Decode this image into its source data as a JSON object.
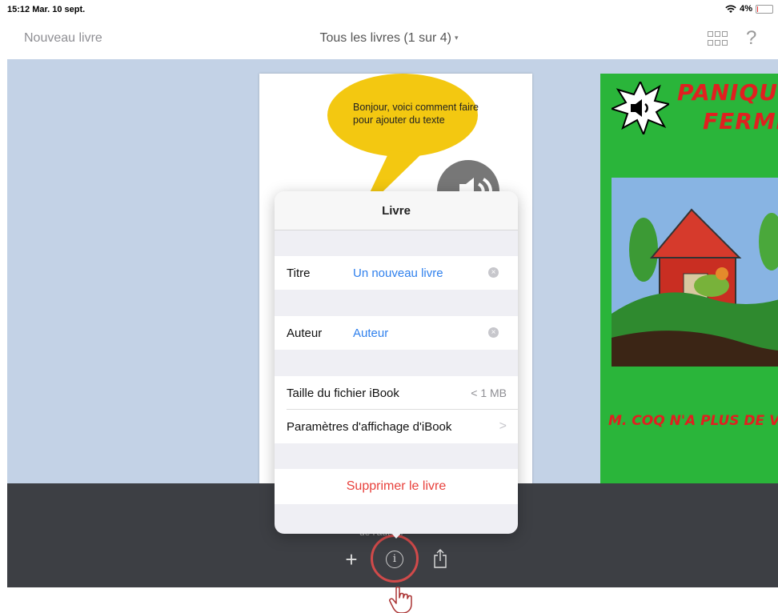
{
  "status_bar": {
    "time": "15:12  Mar. 10 sept.",
    "battery_percent_label": "4%",
    "battery_level": 0.04,
    "icons": [
      "wifi-icon",
      "battery-icon"
    ]
  },
  "nav": {
    "new_book": "Nouveau livre",
    "title": "Tous les livres (1 sur 4)",
    "title_caret": "▾",
    "help": "?",
    "icons": [
      "grid-icon",
      "help-icon"
    ]
  },
  "book_left": {
    "bubble_text": "Bonjour, voici comment faire pour ajouter du texte"
  },
  "book_right": {
    "title_line1": "PANIQUE",
    "title_line2": "FERMI",
    "subtitle": "M. COQ N'A PLUS DE VOI"
  },
  "popover": {
    "title": "Livre",
    "titre_label": "Titre",
    "titre_value": "Un nouveau livre",
    "auteur_label": "Auteur",
    "auteur_value": "Auteur",
    "size_label": "Taille du fichier iBook",
    "size_value": "< 1 MB",
    "display_settings_label": "Paramètres d'affichage d'iBook",
    "chevron": ">",
    "delete_label": "Supprimer le livre",
    "clear_symbol": "×"
  },
  "toolbar": {
    "add": "+",
    "info": "i",
    "partial_label": "de l'auteur",
    "icons": [
      "add-icon",
      "info-icon",
      "share-icon"
    ]
  },
  "colors": {
    "accent_blue": "#2f80ed",
    "destructive_red": "#e8413c",
    "content_bg": "#c3d2e6",
    "toolbar_bg": "#3d3f44",
    "highlight_ring": "#d14a4a"
  }
}
